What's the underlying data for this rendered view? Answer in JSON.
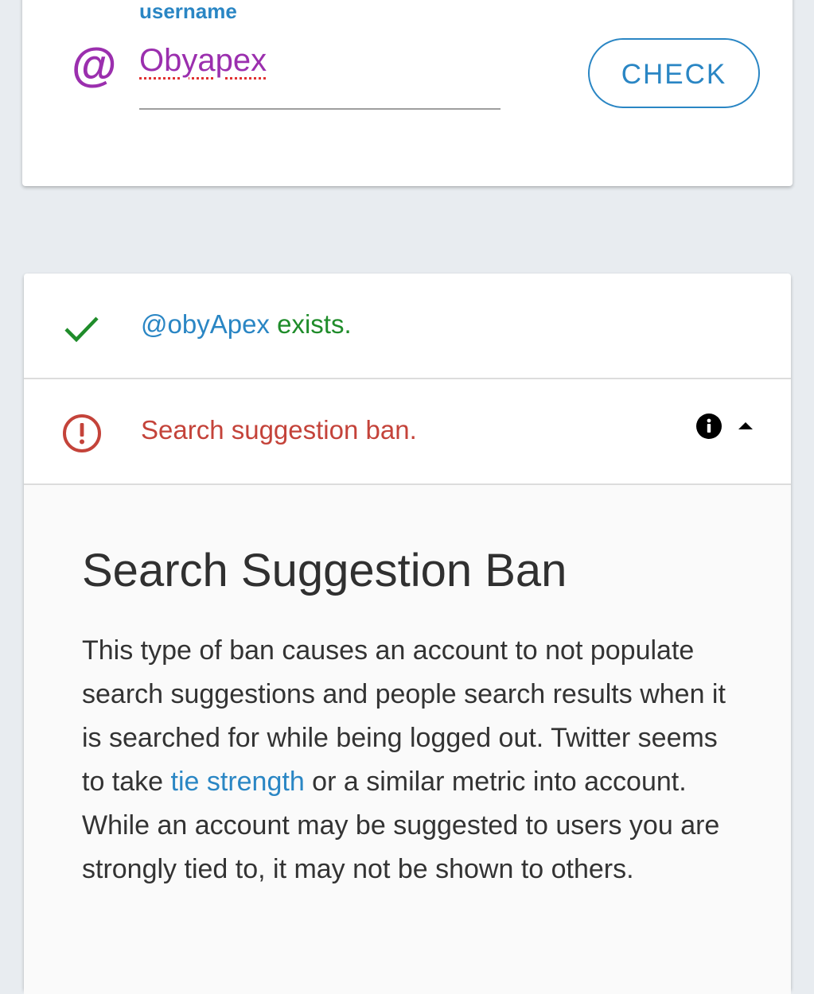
{
  "search": {
    "label": "username",
    "at_symbol": "@",
    "value": "Obyapex",
    "button_label": "CHECK"
  },
  "results": {
    "exists": {
      "icon": "check-icon",
      "handle": "@obyApex",
      "status": " exists."
    },
    "ban": {
      "icon": "alert-circle-icon",
      "label": "Search suggestion ban.",
      "info_icon": "info-icon",
      "toggle_icon": "caret-up-icon"
    },
    "details": {
      "title": "Search Suggestion Ban",
      "text_before_link": "This type of ban causes an account to not populate search suggestions and people search results when it is searched for while being logged out. Twitter seems to take ",
      "link_text": "tie strength",
      "text_after_link": " or a similar metric into account. While an account may be suggested to users you are strongly tied to, it may not be shown to others."
    }
  },
  "colors": {
    "accent_blue": "#2a86c4",
    "purple": "#9b2fae",
    "success_green": "#1f8c2a",
    "error_red": "#c4433a",
    "background": "#e8ecf0"
  }
}
